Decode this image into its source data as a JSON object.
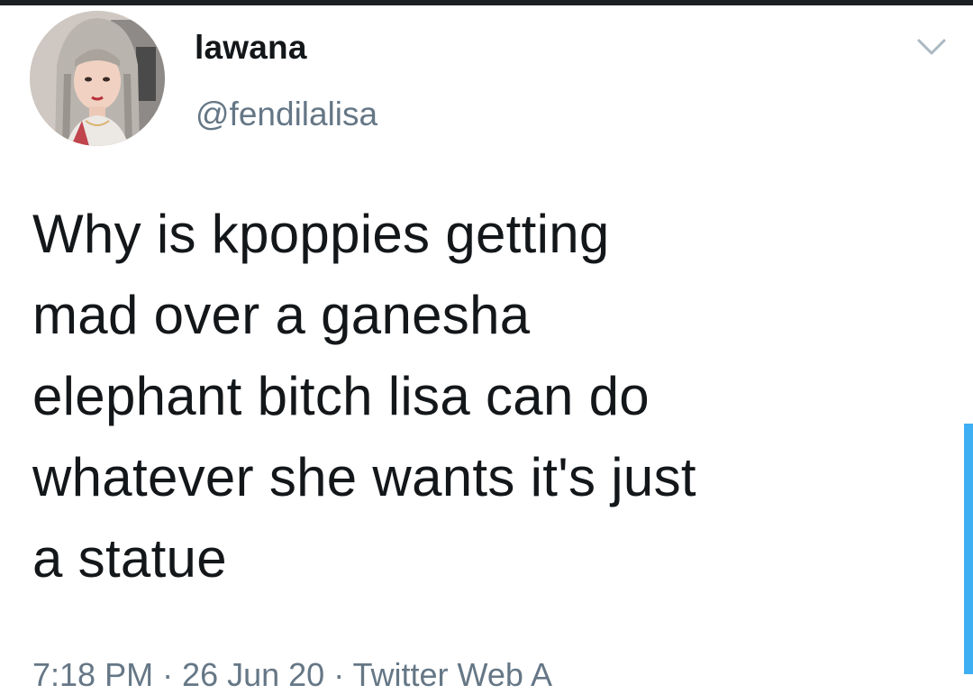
{
  "tweet": {
    "display_name": "lawana",
    "handle": "@fendilalisa",
    "text": "Why is kpoppies getting\nmad over a ganesha\nelephant bitch lisa can do\nwhatever she wants it's just\na statue",
    "meta_partial": "7:18 PM · 26 Jun 20 · Twitter Web A"
  },
  "icons": {
    "avatar": "profile-photo",
    "more": "chevron-down-icon"
  },
  "colors": {
    "text_primary": "#14171a",
    "text_secondary": "#657786",
    "chevron": "#aab8c2",
    "accent": "#1da1f2",
    "top_bar": "#1a1f24"
  }
}
